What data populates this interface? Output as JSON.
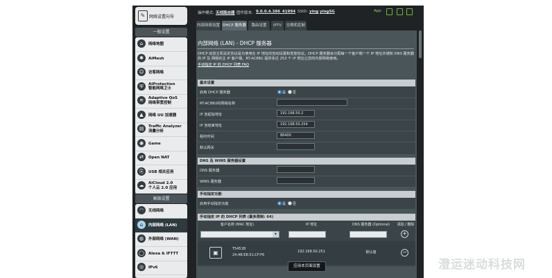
{
  "sidebar": {
    "setup_label": "网络设置向导",
    "general_header": "一般设置",
    "general_items": [
      {
        "label": "网络地图",
        "icon": "network-map-icon",
        "glyph": "⌂"
      },
      {
        "label": "AiMesh",
        "icon": "aimesh-icon",
        "glyph": "✱"
      },
      {
        "label": "访客网络",
        "icon": "guest-network-icon",
        "glyph": "☺"
      },
      {
        "label": "AiProtection",
        "sub": "智能网络卫士",
        "icon": "shield-icon",
        "glyph": "⛨"
      },
      {
        "label": "Adaptive QoS",
        "sub": "网络带宽控制",
        "icon": "qos-icon",
        "glyph": "≋"
      },
      {
        "label": "网络 UU 加速器",
        "icon": "uu-booster-icon",
        "glyph": "▲"
      },
      {
        "label": "Traffic Analyzer",
        "sub": "流量分析",
        "icon": "traffic-analyzer-icon",
        "glyph": "▤"
      },
      {
        "label": "Game",
        "icon": "game-icon",
        "glyph": "◉"
      },
      {
        "label": "Open NAT",
        "icon": "open-nat-icon",
        "glyph": "⇄"
      },
      {
        "label": "USB 相关应用",
        "icon": "usb-icon",
        "glyph": "⎘"
      },
      {
        "label": "AiCloud 2.0",
        "sub": "个人云 2.0 应用",
        "icon": "cloud-icon",
        "glyph": "☁"
      }
    ],
    "advanced_header": "高级设置",
    "advanced_items": [
      {
        "label": "无线网络",
        "icon": "wireless-icon",
        "glyph": "◠",
        "active": false
      },
      {
        "label": "内部网络 (LAN)",
        "icon": "lan-icon",
        "glyph": "⌂",
        "active": true
      },
      {
        "label": "外部网络 (WAN)",
        "icon": "wan-icon",
        "glyph": "◍",
        "active": false
      },
      {
        "label": "Alexa & IFTTT",
        "icon": "alexa-icon",
        "glyph": "◯",
        "active": false
      },
      {
        "label": "IPv6",
        "icon": "ipv6-icon",
        "glyph": "◎",
        "active": false
      }
    ]
  },
  "topbar": {
    "mode_label": "操作模式:",
    "mode_value": "无线路由器",
    "firmware_label": "固件版本:",
    "firmware_value": "9.0.0.4.386_41994",
    "ssid_label": "SSID:",
    "ssid_1": "ying",
    "ssid_2": "yingSG",
    "app_label": "App"
  },
  "tabs": [
    "内部网络设置",
    "DHCP 服务器",
    "路由设置",
    "IPTV",
    "交换机控制"
  ],
  "active_tab": 1,
  "page": {
    "title": "内部网络 (LAN) - DHCP 服务器",
    "description": "DHCP 动态主机设定协议是为使用在 IP 地址的自动设置和发放协议。DHCP 服务器会分配每一个客户端一个 IP 地址并通知 DNS 服务器的 IP 及 网络的主 IP 客户端。RT-AC88U 提供多达 253 个 IP 地址让您的内部网络使用。",
    "faq_link": "手动指定 IP 的 DHCP 列表 FAQ"
  },
  "basic": {
    "header": "基本设置",
    "enable_dhcp_label": "启用 DHCP 服务器",
    "yes_label": "是",
    "no_label": "否",
    "domain_label": "RT-AC88U的网域名称",
    "start_label": "IP 池起始地址",
    "start_value": "192.168.50.2",
    "end_label": "IP 池结束地址",
    "end_value": "192.168.50.254",
    "lease_label": "租约时间",
    "lease_value": "86400",
    "gateway_label": "默认网关"
  },
  "dns_wins": {
    "header": "DNS 及 WINS 服务器设置",
    "dns_label": "DNS 服务器",
    "wins_label": "WINS 服务器"
  },
  "manual": {
    "header": "手动指定功能",
    "enable_label": "启用手动指定功能",
    "yes_label": "是",
    "no_label": "否"
  },
  "table": {
    "header": "手动指定 IP 的 DHCP 列表 (最多限制: 64)",
    "columns": [
      "客户名称 (MAC 地址)",
      "IP 地址",
      "DNS 服务器 (Optional)",
      "添加 / 删除"
    ],
    "rows": [
      {
        "name": "T5451B",
        "mac": "24:4B:E8:51:CF:F6",
        "ip": "192.168.50.251",
        "dns": "默认值"
      }
    ]
  },
  "apply_label": "应用本页面设置",
  "watermark": "澄运迷动科技网"
}
